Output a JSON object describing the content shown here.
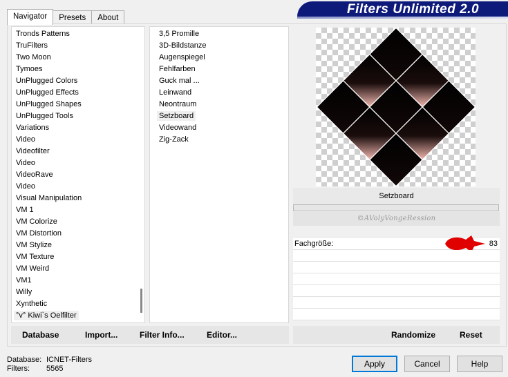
{
  "tabs": [
    {
      "label": "Navigator",
      "active": true
    },
    {
      "label": "Presets",
      "active": false
    },
    {
      "label": "About",
      "active": false
    }
  ],
  "banner": {
    "title": "Filters Unlimited 2.0"
  },
  "categories": [
    "Tronds Patterns",
    "TruFilters",
    "Two Moon",
    "Tymoes",
    "UnPlugged Colors",
    "UnPlugged Effects",
    "UnPlugged Shapes",
    "UnPlugged Tools",
    "Variations",
    "Video",
    "Videofilter",
    "Video",
    "VideoRave",
    "Video",
    "Visual Manipulation",
    "VM 1",
    "VM Colorize",
    "VM Distortion",
    "VM Stylize",
    "VM Texture",
    "VM Weird",
    "VM1",
    "Willy",
    "Xynthetic",
    "°v° Kiwi`s Oelfilter"
  ],
  "selected_category": "°v° Kiwi`s Oelfilter",
  "filters": [
    "3,5 Promille",
    "3D-Bildstanze",
    "Augenspiegel",
    "Fehlfarben",
    "Guck mal ...",
    "Leinwand",
    "Neontraum",
    "Setzboard",
    "Videowand",
    "Zig-Zack"
  ],
  "selected_filter": "Setzboard",
  "preview": {
    "filter_name": "Setzboard",
    "watermark": "©AVolyVongeRession"
  },
  "params": [
    {
      "label": "Fachgröße:",
      "value": "83"
    },
    {
      "label": "",
      "value": ""
    },
    {
      "label": "",
      "value": ""
    },
    {
      "label": "",
      "value": ""
    },
    {
      "label": "",
      "value": ""
    },
    {
      "label": "",
      "value": ""
    },
    {
      "label": "",
      "value": ""
    }
  ],
  "left_buttons": {
    "database": "Database",
    "import": "Import...",
    "filter_info": "Filter Info...",
    "editor": "Editor..."
  },
  "right_buttons": {
    "randomize": "Randomize",
    "reset": "Reset"
  },
  "status": {
    "database_label": "Database:",
    "database_value": "ICNET-Filters",
    "filters_label": "Filters:",
    "filters_value": "5565"
  },
  "dialog": {
    "apply": "Apply",
    "cancel": "Cancel",
    "help": "Help"
  },
  "colors": {
    "banner": "#0d1a7a",
    "accent": "#0078d7",
    "arrow": "#e00000",
    "tile_pink": "#f4b8b0"
  }
}
